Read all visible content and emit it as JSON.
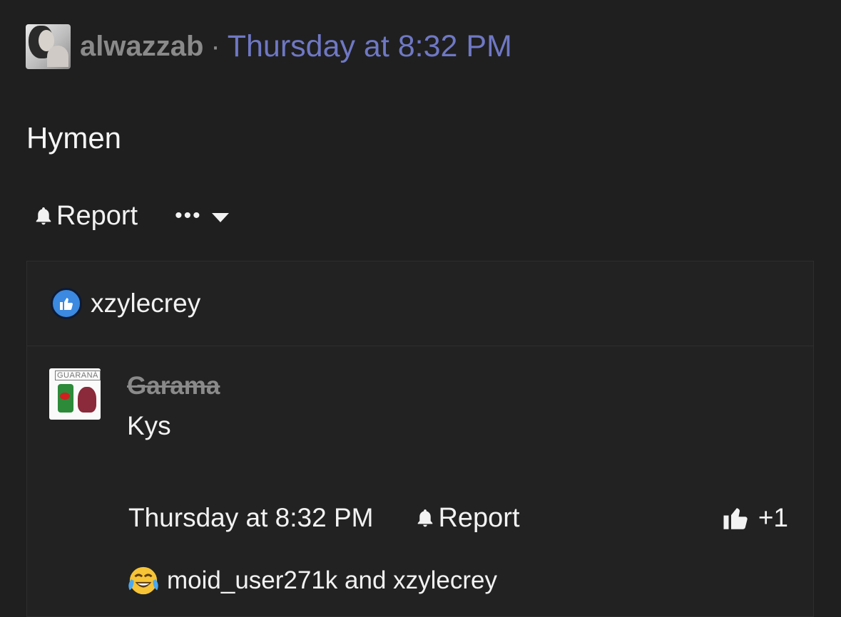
{
  "post": {
    "author": "alwazzab",
    "separator": "·",
    "timestamp": "Thursday at 8:32 PM",
    "body": "Hymen",
    "report_label": "Report",
    "more_label": "•••"
  },
  "likes": {
    "user": "xzylecrey"
  },
  "comment": {
    "avatar_brand": "GUARANÁ",
    "author": "Garama",
    "text": "Kys",
    "timestamp": "Thursday at 8:32 PM",
    "report_label": "Report",
    "like_count": "+1",
    "reaction_users": "moid_user271k and xzylecrey"
  },
  "colors": {
    "background": "#1f1f1f",
    "timestamp_link": "#6f78c4",
    "like_badge": "#3b89e0",
    "muted_text": "#8a8a8a"
  },
  "icons": [
    "bell-icon",
    "ellipsis-icon",
    "chevron-down-icon",
    "thumbs-up-icon",
    "crying-laughing-emoji-icon"
  ]
}
